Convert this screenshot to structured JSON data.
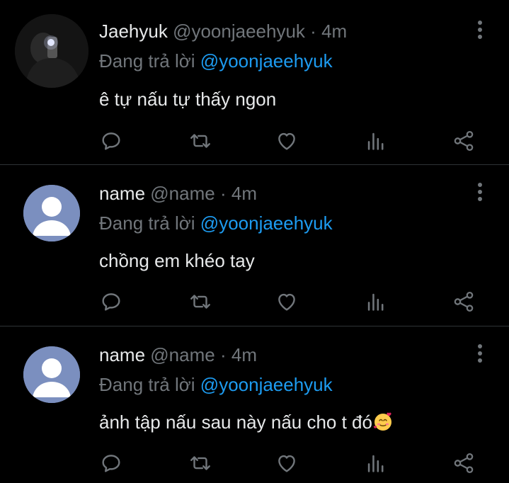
{
  "tweets": [
    {
      "name": "Jaehyuk",
      "handle": "@yoonjaeehyuk",
      "separator": "·",
      "time": "4m",
      "reply_prefix": "Đang trả lời",
      "reply_to": "@yoonjaeehyuk",
      "text": "ê tự nấu tự thấy ngon",
      "avatar": "photo"
    },
    {
      "name": "name",
      "handle": "@name",
      "separator": "·",
      "time": "4m",
      "reply_prefix": "Đang trả lời",
      "reply_to": "@yoonjaeehyuk",
      "text": "chồng em khéo tay",
      "avatar": "default-avatar"
    },
    {
      "name": "name",
      "handle": "@name",
      "separator": "·",
      "time": "4m",
      "reply_prefix": "Đang trả lời",
      "reply_to": "@yoonjaeehyuk",
      "text": "ảnh tập nấu sau này nấu cho t đó",
      "text_emoji": "smiling-face-with-hearts",
      "avatar": "default-avatar"
    }
  ],
  "icons": {
    "reply": "reply-icon",
    "retweet": "retweet-icon",
    "like": "heart-icon",
    "views": "analytics-icon",
    "share": "share-icon",
    "more": "more-vertical-icon"
  },
  "colors": {
    "background": "#000000",
    "text": "#e7e9ea",
    "secondary": "#71767b",
    "accent": "#1d9bf0",
    "divider": "#2f3336",
    "default_avatar": "#7b8fbf"
  }
}
